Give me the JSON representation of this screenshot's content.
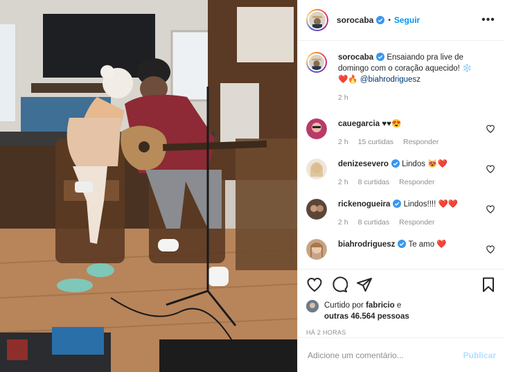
{
  "header": {
    "username": "sorocaba",
    "separator": "•",
    "follow_label": "Seguir",
    "more_label": "•••"
  },
  "caption": {
    "username": "sorocaba",
    "text": "Ensaiando pra live de domingo com o coração aquecido!",
    "emojis": "❄️❤️🔥",
    "mention": "@biahrodriguesz",
    "time": "2 h"
  },
  "comments": [
    {
      "username": "cauegarcia",
      "verified": false,
      "text": "♥♥😍",
      "time": "2 h",
      "likes": "15 curtidas",
      "reply": "Responder",
      "avatar_color": "#b83b6a"
    },
    {
      "username": "denizesevero",
      "verified": true,
      "text": "Lindos 😻❤️",
      "time": "2 h",
      "likes": "8 curtidas",
      "reply": "Responder",
      "avatar_color": "#d9c2a4"
    },
    {
      "username": "rickenogueira",
      "verified": true,
      "text": "Lindos!!!! ❤️❤️",
      "time": "2 h",
      "likes": "8 curtidas",
      "reply": "Responder",
      "avatar_color": "#5b4638"
    },
    {
      "username": "biahrodriguesz",
      "verified": true,
      "text": "Te amo ❤️",
      "time": "",
      "likes": "",
      "reply": "",
      "avatar_color": "#c7a486"
    }
  ],
  "actions": {
    "like_icon": "heart-outline-icon",
    "comment_icon": "speech-bubble-icon",
    "share_icon": "paper-plane-icon",
    "save_icon": "bookmark-icon"
  },
  "likes": {
    "prefix": "Curtido por",
    "user": "fabricio",
    "conj": "e",
    "others": "outras 46.564 pessoas"
  },
  "timestamp": "HÁ 2 HORAS",
  "add_comment": {
    "placeholder": "Adicione um comentário...",
    "publish_label": "Publicar"
  },
  "colors": {
    "link_blue": "#0095f6",
    "publish_disabled": "#b2dffc",
    "muted": "#8e8e8e",
    "mention": "#00376b",
    "verified": "#3897f0",
    "heart_red": "#ed4956"
  }
}
